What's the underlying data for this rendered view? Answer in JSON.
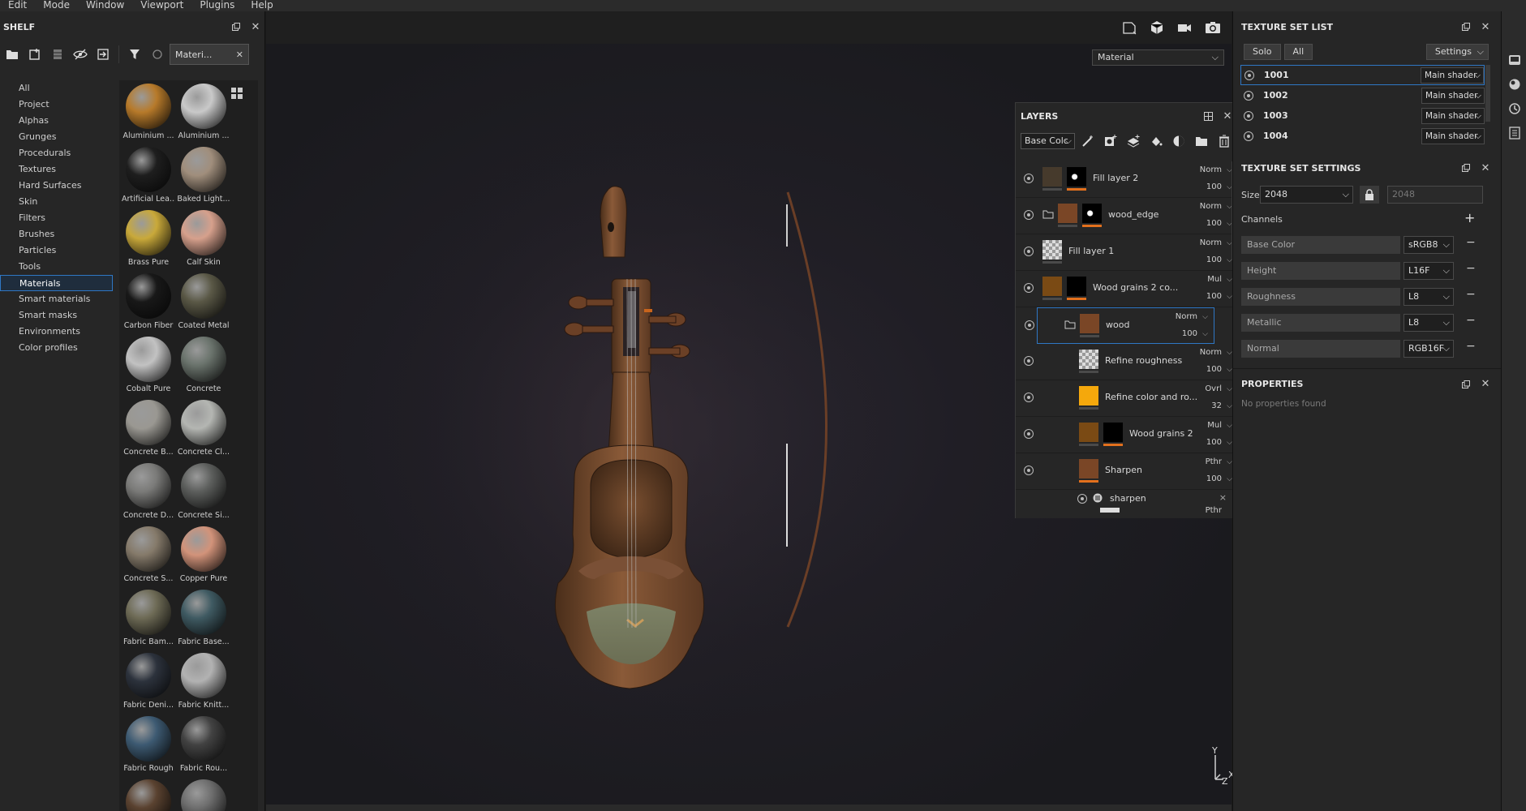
{
  "menu": [
    "Edit",
    "Mode",
    "Window",
    "Viewport",
    "Plugins",
    "Help"
  ],
  "shelf": {
    "title": "SHELF",
    "tab_label": "Materi...",
    "categories": [
      "All",
      "Project",
      "Alphas",
      "Grunges",
      "Procedurals",
      "Textures",
      "Hard Surfaces",
      "Skin",
      "Filters",
      "Brushes",
      "Particles",
      "Tools",
      "Materials",
      "Smart materials",
      "Smart masks",
      "Environments",
      "Color profiles"
    ],
    "selected_category": "Materials",
    "materials": [
      {
        "label": "Aluminium ...",
        "color": "#b77a2a"
      },
      {
        "label": "Aluminium ...",
        "color": "#c9c9c9"
      },
      {
        "label": "Artificial Lea...",
        "color": "#1e1e1e"
      },
      {
        "label": "Baked Light...",
        "color": "#a08e7c"
      },
      {
        "label": "Brass Pure",
        "color": "#c9a93a"
      },
      {
        "label": "Calf Skin",
        "color": "#d6a08c"
      },
      {
        "label": "Carbon Fiber",
        "color": "#181818"
      },
      {
        "label": "Coated Metal",
        "color": "#5a5846"
      },
      {
        "label": "Cobalt Pure",
        "color": "#c2c2c2"
      },
      {
        "label": "Concrete",
        "color": "#6a736c"
      },
      {
        "label": "Concrete B...",
        "color": "#9a9892"
      },
      {
        "label": "Concrete Cl...",
        "color": "#b4b6b2"
      },
      {
        "label": "Concrete D...",
        "color": "#7a7a78"
      },
      {
        "label": "Concrete Si...",
        "color": "#5c5e5c"
      },
      {
        "label": "Concrete S...",
        "color": "#857a6a"
      },
      {
        "label": "Copper Pure",
        "color": "#d2937a"
      },
      {
        "label": "Fabric Bam...",
        "color": "#6d6a55"
      },
      {
        "label": "Fabric Base...",
        "color": "#3f5a62"
      },
      {
        "label": "Fabric Deni...",
        "color": "#2c323c"
      },
      {
        "label": "Fabric Knitt...",
        "color": "#b2b2b2"
      },
      {
        "label": "Fabric Rough",
        "color": "#3d5a72"
      },
      {
        "label": "Fabric Rou...",
        "color": "#424242"
      },
      {
        "label": "",
        "color": "#5a4230"
      },
      {
        "label": "",
        "color": "#6e6e6e"
      }
    ]
  },
  "viewport": {
    "material_mode": "Material",
    "axis": {
      "y": "Y",
      "z": "Z",
      "x": "X"
    }
  },
  "layers": {
    "title": "LAYERS",
    "channel": "Base Colc",
    "items": [
      {
        "name": "Fill layer 2",
        "blend": "Norm",
        "opacity": "100"
      },
      {
        "name": "wood_edge",
        "blend": "Norm",
        "opacity": "100"
      },
      {
        "name": "Fill layer 1",
        "blend": "Norm",
        "opacity": "100"
      },
      {
        "name": "Wood grains 2 co...",
        "blend": "Mul",
        "opacity": "100"
      },
      {
        "name": "wood",
        "blend": "Norm",
        "opacity": "100"
      },
      {
        "name": "Refine roughness",
        "blend": "Norm",
        "opacity": "100"
      },
      {
        "name": "Refine color and ro...",
        "blend": "Ovrl",
        "opacity": "32"
      },
      {
        "name": "Wood grains 2",
        "blend": "Mul",
        "opacity": "100"
      },
      {
        "name": "Sharpen",
        "blend": "Pthr",
        "opacity": "100"
      }
    ],
    "effect": {
      "name": "sharpen",
      "close": "×"
    },
    "next_blend": "Pthr"
  },
  "texture_set_list": {
    "title": "TEXTURE SET LIST",
    "solo": "Solo",
    "all": "All",
    "settings": "Settings",
    "sets": [
      {
        "id": "1001",
        "shader": "Main shader"
      },
      {
        "id": "1002",
        "shader": "Main shader"
      },
      {
        "id": "1003",
        "shader": "Main shader"
      },
      {
        "id": "1004",
        "shader": "Main shader"
      }
    ]
  },
  "texture_set_settings": {
    "title": "TEXTURE SET SETTINGS",
    "size_label": "Size",
    "size_value": "2048",
    "size_linked": "2048",
    "channels_label": "Channels",
    "channels": [
      {
        "name": "Base Color",
        "format": "sRGB8"
      },
      {
        "name": "Height",
        "format": "L16F"
      },
      {
        "name": "Roughness",
        "format": "L8"
      },
      {
        "name": "Metallic",
        "format": "L8"
      },
      {
        "name": "Normal",
        "format": "RGB16F"
      }
    ]
  },
  "properties": {
    "title": "PROPERTIES",
    "empty_text": "No properties found"
  }
}
